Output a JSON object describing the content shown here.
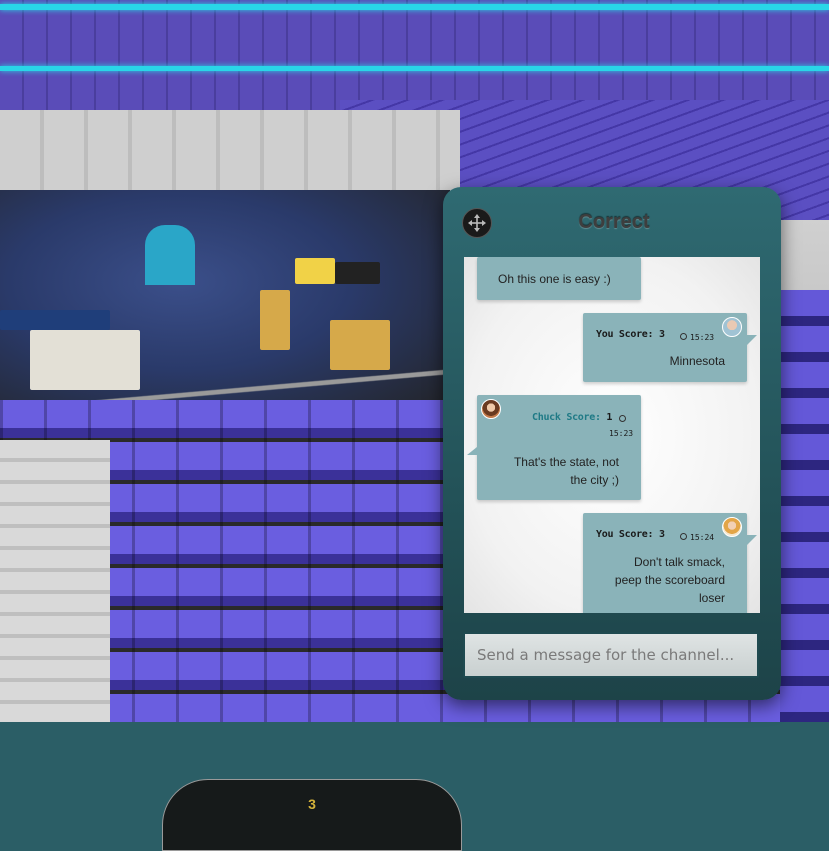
{
  "chat": {
    "title": "Correct",
    "input_placeholder": "Send a message for the channel..."
  },
  "messages": [
    {
      "side": "left",
      "author": "",
      "text": "Oh this one is easy :)"
    },
    {
      "side": "right",
      "author_label": "You",
      "score_label": "Score:",
      "score": "3",
      "time": "15:23",
      "text": "Minnesota"
    },
    {
      "side": "left",
      "author_label": "Chuck",
      "score_label": "Score:",
      "score": "1",
      "time": "15:23",
      "text_line1": "That's the state, not",
      "text_line2": "the city ;)"
    },
    {
      "side": "right",
      "author_label": "You",
      "score_label": "Score:",
      "score": "3",
      "time": "15:24",
      "text_line1": "Don't talk smack,",
      "text_line2": "peep the scoreboard",
      "text_line3": "loser"
    }
  ],
  "scoreboard": {
    "value": "3"
  },
  "colors": {
    "panel": "#2f6a72",
    "bubble": "#8ab3b9",
    "score": "#d4b23a"
  },
  "icons": {
    "move": "move-arrows-icon",
    "time": "clock-icon"
  }
}
